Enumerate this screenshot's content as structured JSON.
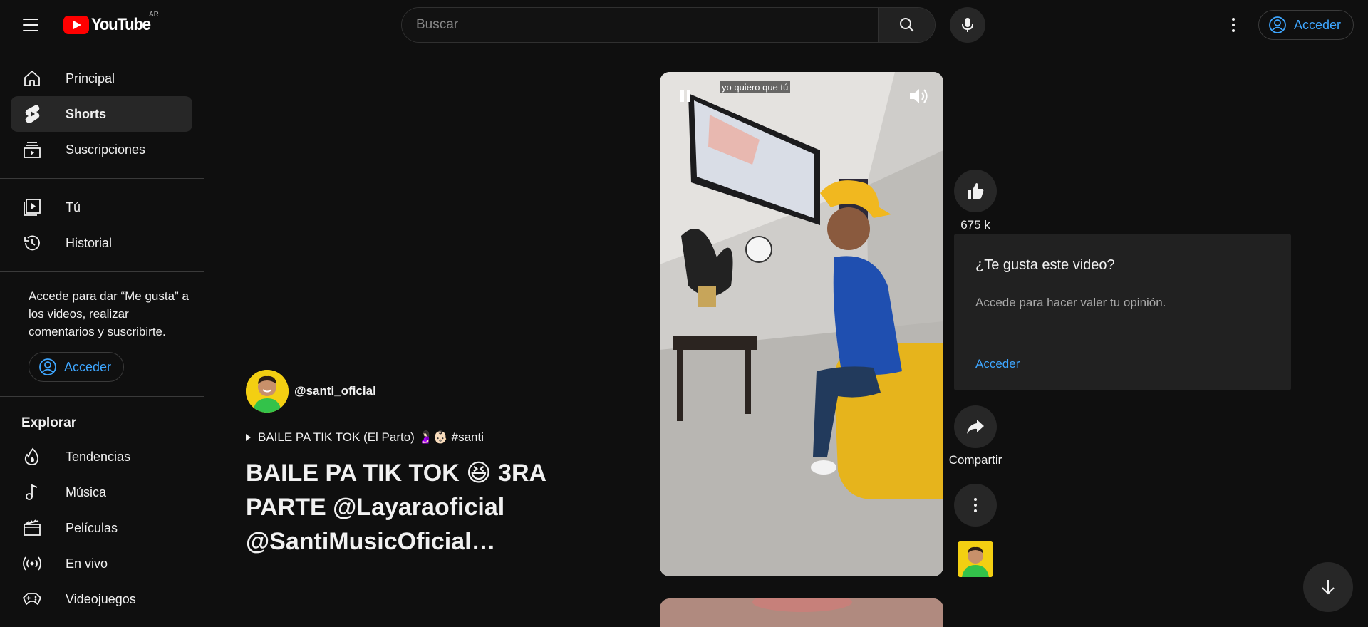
{
  "header": {
    "logo_text": "YouTube",
    "country_code": "AR",
    "search_placeholder": "Buscar",
    "signin_label": "Acceder"
  },
  "sidebar": {
    "items": [
      {
        "label": "Principal",
        "icon": "home-icon"
      },
      {
        "label": "Shorts",
        "icon": "shorts-icon",
        "active": true
      },
      {
        "label": "Suscripciones",
        "icon": "subscriptions-icon"
      },
      {
        "label": "Tú",
        "icon": "you-icon"
      },
      {
        "label": "Historial",
        "icon": "history-icon"
      }
    ],
    "signin_prompt": "Accede para dar “Me gusta” a los videos, realizar comentarios y suscribirte.",
    "signin_label": "Acceder",
    "explore_title": "Explorar",
    "explore_items": [
      {
        "label": "Tendencias",
        "icon": "trending-icon"
      },
      {
        "label": "Música",
        "icon": "music-icon"
      },
      {
        "label": "Películas",
        "icon": "movies-icon"
      },
      {
        "label": "En vivo",
        "icon": "live-icon"
      },
      {
        "label": "Videojuegos",
        "icon": "gaming-icon"
      }
    ]
  },
  "short": {
    "channel": "@santi_oficial",
    "audio": "BAILE PA TIK TOK (El Parto) 🤰🏻👶🏻 #santi",
    "title": "BAILE PA TIK TOK 😆 3RA PARTE @Layaraoficial @SantiMusicOficial…",
    "caption": "yo quiero que tú",
    "like_count": "675 k",
    "share_label": "Compartir"
  },
  "popup": {
    "title": "¿Te gusta este video?",
    "subtitle": "Accede para hacer valer tu opinión.",
    "link": "Acceder"
  },
  "colors": {
    "background": "#0f0f0f",
    "accent_link": "#3ea6ff",
    "brand_red": "#ff0000",
    "chip": "#272727"
  }
}
